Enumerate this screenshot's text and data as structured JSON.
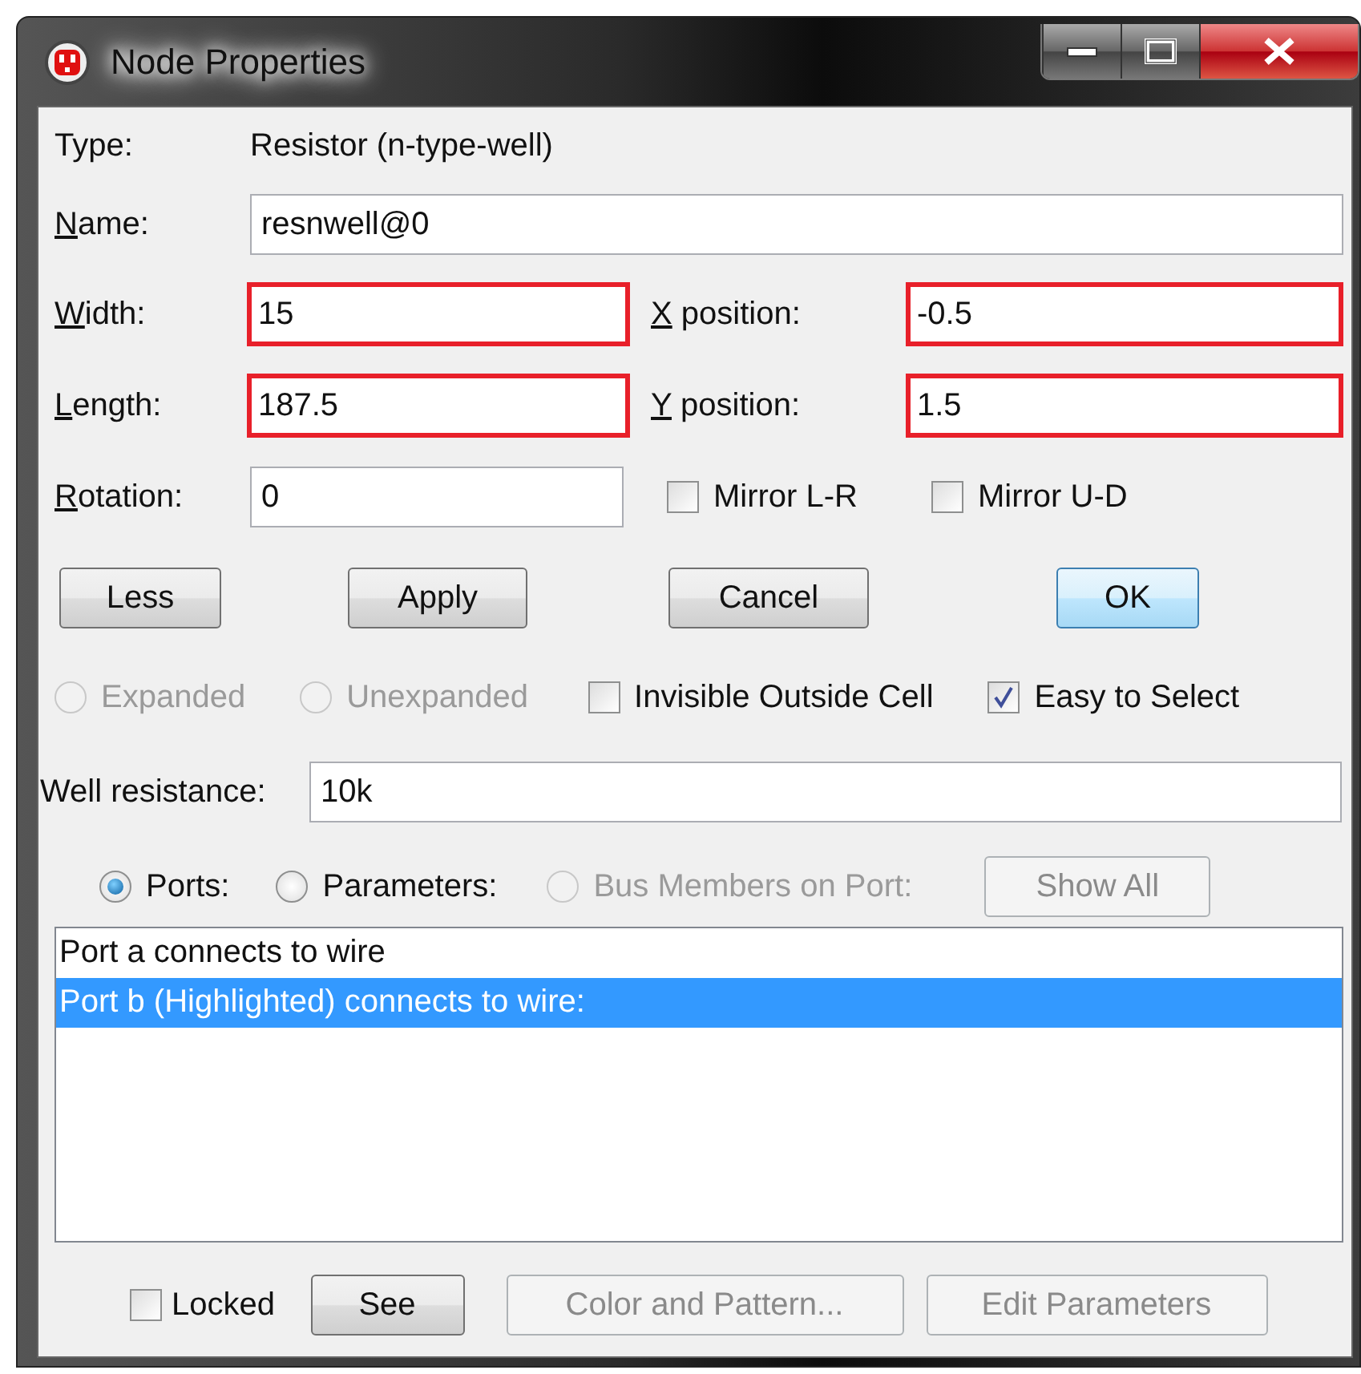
{
  "window": {
    "title": "Node Properties"
  },
  "type": {
    "label": "Type:",
    "value": "Resistor (n-type-well)"
  },
  "name": {
    "label": "Name:",
    "mnemonic": true,
    "value": "resnwell@0",
    "highlighted": false
  },
  "size_rows": [
    {
      "left": {
        "label": "Width:",
        "mnemonic": true,
        "value": "15",
        "highlighted": true
      },
      "right": {
        "label": "X position:",
        "mnemonic": true,
        "value": "-0.5",
        "highlighted": true
      }
    },
    {
      "left": {
        "label": "Length:",
        "mnemonic": true,
        "value": "187.5",
        "highlighted": true
      },
      "right": {
        "label": "Y position:",
        "mnemonic": true,
        "value": "1.5",
        "highlighted": true
      }
    }
  ],
  "rotation": {
    "label": "Rotation:",
    "mnemonic": true,
    "value": "0",
    "highlighted": false
  },
  "mirrors": [
    {
      "label": "Mirror L-R",
      "checked": false
    },
    {
      "label": "Mirror U-D",
      "checked": false
    }
  ],
  "buttons": [
    {
      "label": "Less",
      "default": false
    },
    {
      "label": "Apply",
      "default": false
    },
    {
      "label": "Cancel",
      "default": false
    },
    {
      "label": "OK",
      "default": true
    }
  ],
  "options": [
    {
      "kind": "radio",
      "label": "Expanded",
      "selected": false,
      "disabled": true
    },
    {
      "kind": "radio",
      "label": "Unexpanded",
      "selected": false,
      "disabled": true
    },
    {
      "kind": "checkbox",
      "label": "Invisible Outside Cell",
      "checked": false,
      "disabled": false
    },
    {
      "kind": "checkbox",
      "label": "Easy to Select",
      "checked": true,
      "disabled": false
    }
  ],
  "well_resistance": {
    "label": "Well resistance:",
    "value": "10k"
  },
  "view_modes": [
    {
      "label": "Ports:",
      "selected": true,
      "disabled": false
    },
    {
      "label": "Parameters:",
      "selected": false,
      "disabled": false
    },
    {
      "label": "Bus Members on Port:",
      "selected": false,
      "disabled": true
    }
  ],
  "show_all": {
    "label": "Show All",
    "disabled": true
  },
  "ports_list": [
    {
      "text": "Port a connects to wire",
      "selected": false
    },
    {
      "text": "Port b (Highlighted) connects to wire:",
      "selected": true
    }
  ],
  "footer": {
    "locked": {
      "label": "Locked",
      "checked": false
    },
    "buttons": [
      {
        "label": "See",
        "disabled": false
      },
      {
        "label": "Color and Pattern...",
        "disabled": true
      },
      {
        "label": "Edit Parameters",
        "disabled": true
      }
    ]
  }
}
